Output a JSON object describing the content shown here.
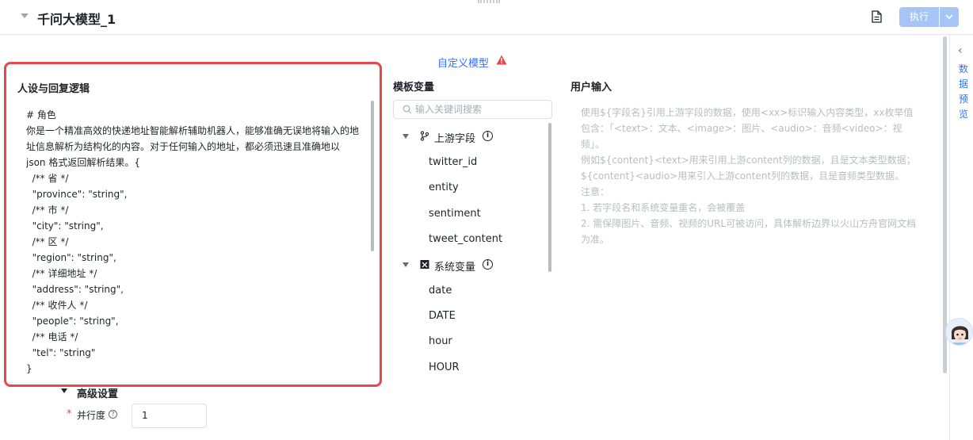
{
  "header": {
    "title": "千问大模型_1",
    "run_label": "执行"
  },
  "model": {
    "custom_model_label": "自定义模型"
  },
  "persona": {
    "title": "人设与回复逻辑",
    "prompt": "# 角色\n你是一个精准高效的快递地址智能解析辅助机器人，能够准确无误地将输入的地址信息解析为结构化的内容。对于任何输入的地址，都必须迅速且准确地以 json 格式返回解析结果。{\n  /** 省 */\n  \"province\": \"string\",\n  /** 市 */\n  \"city\": \"string\",\n  /** 区 */\n  \"region\": \"string\",\n  /** 详细地址 */\n  \"address\": \"string\",\n  /** 收件人 */\n  \"people\": \"string\",\n  /** 电话 */\n  \"tel\": \"string\"\n}"
  },
  "template_vars": {
    "title": "模板变量",
    "search_placeholder": "输入关键词搜索",
    "groups": [
      {
        "label": "上游字段",
        "icon": "branch-icon",
        "items": [
          "twitter_id",
          "entity",
          "sentiment",
          "tweet_content"
        ]
      },
      {
        "label": "系统变量",
        "icon": "system-icon",
        "items": [
          "date",
          "DATE",
          "hour",
          "HOUR"
        ]
      }
    ]
  },
  "user_input": {
    "title": "用户输入",
    "hint": "使用${字段名}引用上游字段的数据，使用<xx>标识输入内容类型，xx枚举值包含：「<text>：文本、<image>：图片、<audio>：音频<video>：视频」。\n例如${content}<text>用来引用上游content列的数据，且是文本类型数据；${content}<audio>用来引入上游content列的数据，且是音频类型数据。\n注意：\n1. 若字段名和系统变量重名，会被覆盖\n2. 需保障图片、音频、视频的URL可被访问，具体解析边界以火山方舟官网文档为准。"
  },
  "advanced": {
    "label": "高级设置",
    "parallel_label": "并行度",
    "parallel_value": "1"
  },
  "rail": {
    "label": "数据预览"
  },
  "colors": {
    "accent": "#3370ff",
    "highlight_border": "#e5484d",
    "run_button": "#a6c4f5"
  }
}
